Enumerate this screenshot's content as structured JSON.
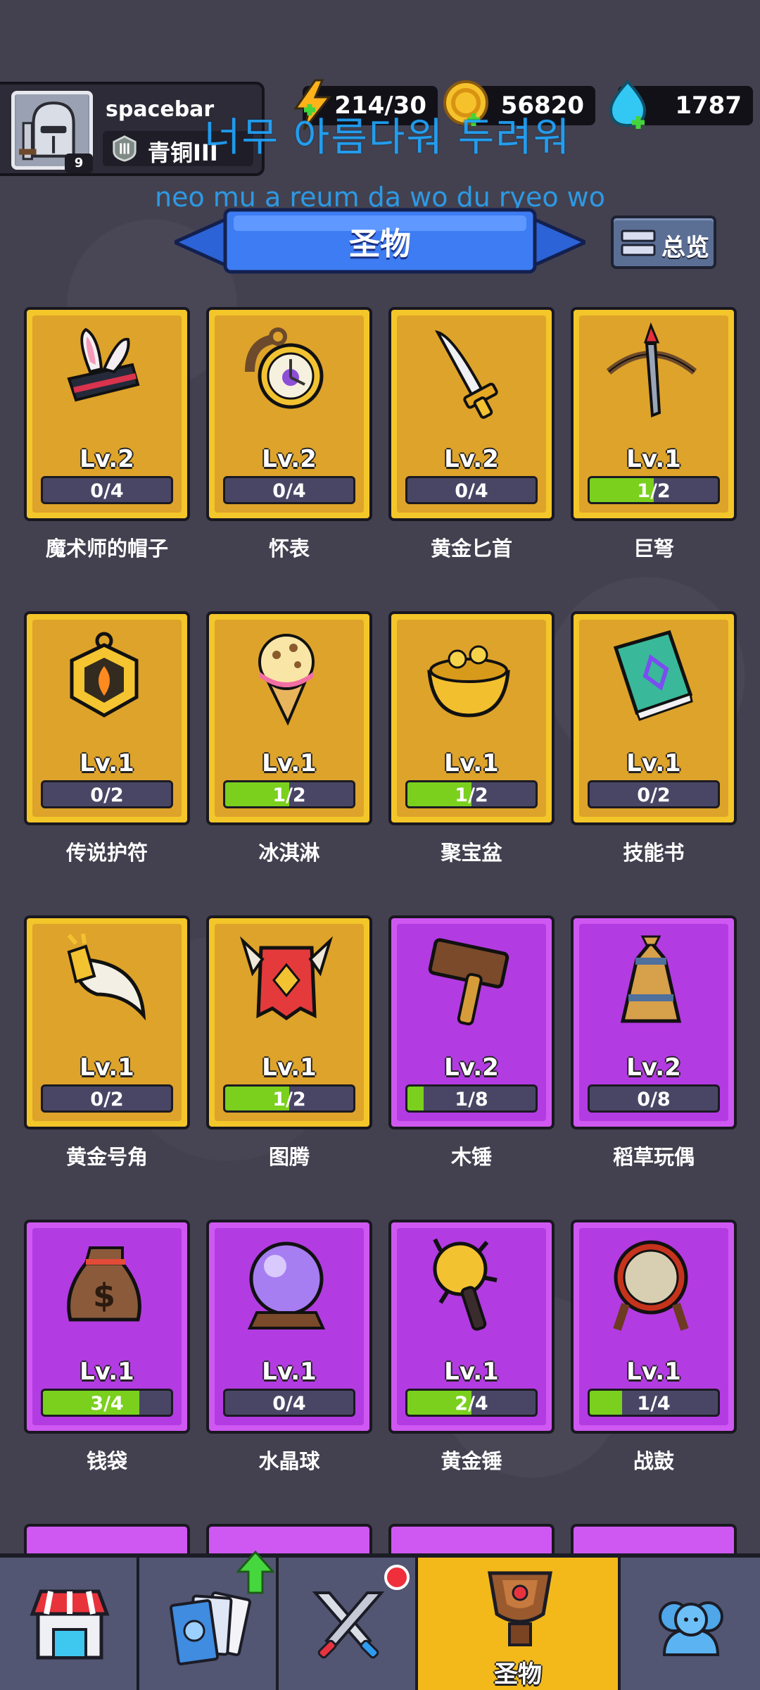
{
  "player": {
    "name": "spacebar",
    "level": "9",
    "rank": "青铜III"
  },
  "resources": {
    "energy": "214/30",
    "gold": "56820",
    "gems": "1787"
  },
  "lyrics": {
    "korean": "너무 아름다워 두려워",
    "romanized": "neo mu a reum da wo du ryeo wo"
  },
  "header": {
    "title": "圣物",
    "overview_label": "总览"
  },
  "colors": {
    "gold_card": "#dea32a",
    "purple_card": "#b33be2",
    "progress_green": "#7ad01d",
    "active_tab": "#f3b91b"
  },
  "relics": [
    {
      "name": "魔术师的帽子",
      "level": "Lv.2",
      "progress": "0/4",
      "fill": 0,
      "rarity": "gold",
      "icon": "magician-hat-icon"
    },
    {
      "name": "怀表",
      "level": "Lv.2",
      "progress": "0/4",
      "fill": 0,
      "rarity": "gold",
      "icon": "pocket-watch-icon"
    },
    {
      "name": "黄金匕首",
      "level": "Lv.2",
      "progress": "0/4",
      "fill": 0,
      "rarity": "gold",
      "icon": "golden-dagger-icon"
    },
    {
      "name": "巨弩",
      "level": "Lv.1",
      "progress": "1/2",
      "fill": 0.5,
      "rarity": "gold",
      "icon": "crossbow-icon"
    },
    {
      "name": "传说护符",
      "level": "Lv.1",
      "progress": "0/2",
      "fill": 0,
      "rarity": "gold",
      "icon": "amulet-icon"
    },
    {
      "name": "冰淇淋",
      "level": "Lv.1",
      "progress": "1/2",
      "fill": 0.5,
      "rarity": "gold",
      "icon": "ice-cream-icon"
    },
    {
      "name": "聚宝盆",
      "level": "Lv.1",
      "progress": "1/2",
      "fill": 0.5,
      "rarity": "gold",
      "icon": "treasure-pot-icon"
    },
    {
      "name": "技能书",
      "level": "Lv.1",
      "progress": "0/2",
      "fill": 0,
      "rarity": "gold",
      "icon": "skill-book-icon"
    },
    {
      "name": "黄金号角",
      "level": "Lv.1",
      "progress": "0/2",
      "fill": 0,
      "rarity": "gold",
      "icon": "golden-horn-icon"
    },
    {
      "name": "图腾",
      "level": "Lv.1",
      "progress": "1/2",
      "fill": 0.5,
      "rarity": "gold",
      "icon": "totem-banner-icon"
    },
    {
      "name": "木锤",
      "level": "Lv.2",
      "progress": "1/8",
      "fill": 0.125,
      "rarity": "purple",
      "icon": "wooden-hammer-icon"
    },
    {
      "name": "稻草玩偶",
      "level": "Lv.2",
      "progress": "0/8",
      "fill": 0,
      "rarity": "purple",
      "icon": "straw-doll-icon"
    },
    {
      "name": "钱袋",
      "level": "Lv.1",
      "progress": "3/4",
      "fill": 0.75,
      "rarity": "purple",
      "icon": "money-bag-icon"
    },
    {
      "name": "水晶球",
      "level": "Lv.1",
      "progress": "0/4",
      "fill": 0,
      "rarity": "purple",
      "icon": "crystal-ball-icon"
    },
    {
      "name": "黄金锤",
      "level": "Lv.1",
      "progress": "2/4",
      "fill": 0.5,
      "rarity": "purple",
      "icon": "golden-mace-icon"
    },
    {
      "name": "战鼓",
      "level": "Lv.1",
      "progress": "1/4",
      "fill": 0.25,
      "rarity": "purple",
      "icon": "war-drum-icon"
    }
  ],
  "nav": {
    "active_label": "圣物",
    "items": [
      "shop-icon",
      "cards-icon",
      "battle-icon",
      "relic-icon",
      "social-icon"
    ]
  }
}
